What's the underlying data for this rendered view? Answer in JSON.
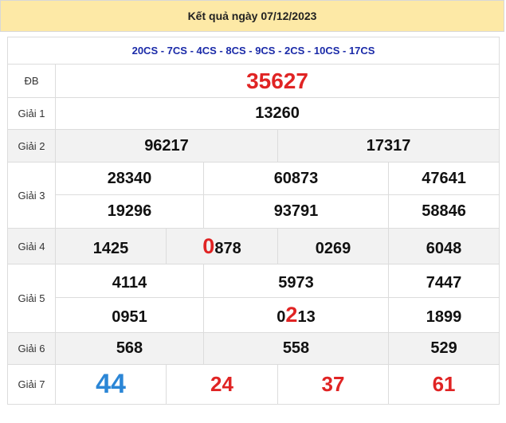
{
  "header": {
    "title": "Kết quả ngày 07/12/2023"
  },
  "codes": "20CS - 7CS - 4CS - 8CS - 9CS - 2CS - 10CS - 17CS",
  "prizes": {
    "db": {
      "label": "ĐB",
      "value": "35627"
    },
    "g1": {
      "label": "Giải 1",
      "value": "13260"
    },
    "g2": {
      "label": "Giải 2",
      "values": [
        "96217",
        "17317"
      ]
    },
    "g3": {
      "label": "Giải 3",
      "values": [
        "28340",
        "60873",
        "47641",
        "19296",
        "93791",
        "58846"
      ]
    },
    "g4": {
      "label": "Giải 4",
      "values": [
        {
          "pre": "",
          "hl": "",
          "post": "1425"
        },
        {
          "pre": "",
          "hl": "0",
          "post": "878"
        },
        {
          "pre": "",
          "hl": "",
          "post": "0269"
        },
        {
          "pre": "",
          "hl": "",
          "post": "6048"
        }
      ]
    },
    "g5": {
      "label": "Giải 5",
      "values": [
        {
          "pre": "4114",
          "hl": "",
          "post": ""
        },
        {
          "pre": "5973",
          "hl": "",
          "post": ""
        },
        {
          "pre": "7447",
          "hl": "",
          "post": ""
        },
        {
          "pre": "0951",
          "hl": "",
          "post": ""
        },
        {
          "pre": "0",
          "hl": "2",
          "post": "13"
        },
        {
          "pre": "1899",
          "hl": "",
          "post": ""
        }
      ]
    },
    "g6": {
      "label": "Giải 6",
      "values": [
        "568",
        "558",
        "529"
      ]
    },
    "g7": {
      "label": "Giải 7",
      "values": [
        "44",
        "24",
        "37",
        "61"
      ]
    }
  },
  "colors": {
    "header_bg": "#fde9a6",
    "codes": "#1a2aa8",
    "highlight": "#e02424",
    "g7_first": "#2b86d6",
    "row_shade": "#f2f2f2"
  }
}
